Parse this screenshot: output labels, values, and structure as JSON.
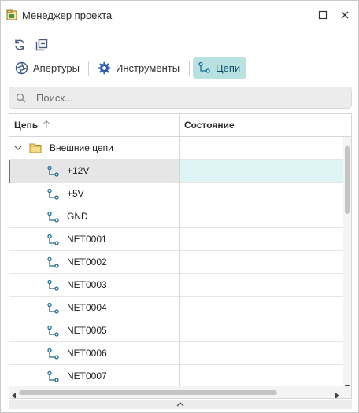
{
  "window": {
    "title": "Менеджер проекта"
  },
  "toolbar": {
    "refresh_icon": "refresh-icon",
    "collapse_icon": "collapse-all-icon"
  },
  "tabs": [
    {
      "label": "Апертуры",
      "icon": "aperture-icon",
      "active": false
    },
    {
      "label": "Инструменты",
      "icon": "tool-gear-icon",
      "active": false
    },
    {
      "label": "Цепи",
      "icon": "net-icon",
      "active": true
    }
  ],
  "search": {
    "placeholder": "Поиск...",
    "value": ""
  },
  "grid": {
    "columns": [
      {
        "label": "Цепь",
        "sort": "ascending"
      },
      {
        "label": "Состояние"
      }
    ],
    "group": {
      "label": "Внешние цепи",
      "expanded": true
    },
    "rows": [
      {
        "net": "+12V",
        "state": "",
        "selected": true
      },
      {
        "net": "+5V",
        "state": ""
      },
      {
        "net": "GND",
        "state": ""
      },
      {
        "net": "NET0001",
        "state": ""
      },
      {
        "net": "NET0002",
        "state": ""
      },
      {
        "net": "NET0003",
        "state": ""
      },
      {
        "net": "NET0004",
        "state": ""
      },
      {
        "net": "NET0005",
        "state": ""
      },
      {
        "net": "NET0006",
        "state": ""
      },
      {
        "net": "NET0007",
        "state": ""
      }
    ]
  },
  "colors": {
    "accent_tab_bg": "#b8e2e2",
    "selection_border": "#2f8f8c",
    "net_icon": "#1a6b92"
  }
}
